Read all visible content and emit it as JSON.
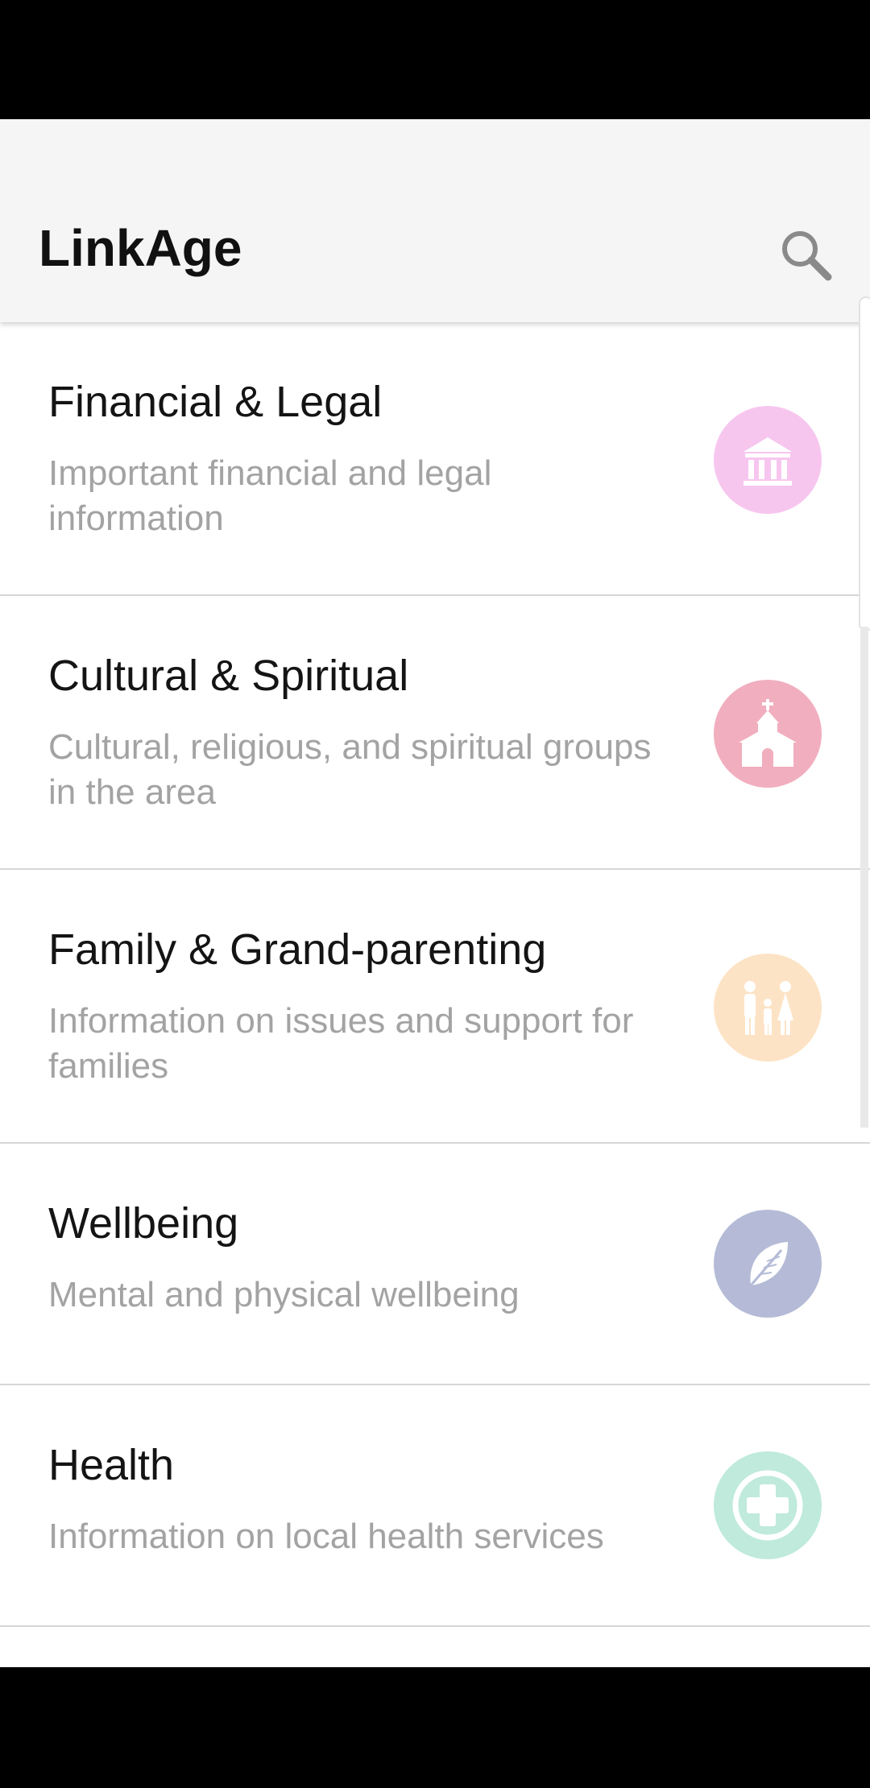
{
  "app_bar": {
    "title": "LinkAge",
    "search_icon": "search-icon"
  },
  "categories": [
    {
      "title": "Financial & Legal",
      "description": "Important financial and legal information",
      "icon": "bank-icon",
      "color": "#f7c6ef"
    },
    {
      "title": "Cultural & Spiritual",
      "description": "Cultural, religious, and spiritual groups in the area",
      "icon": "church-icon",
      "color": "#f1aebe"
    },
    {
      "title": "Family & Grand-parenting",
      "description": "Information on issues and support for families",
      "icon": "family-icon",
      "color": "#fde3c5"
    },
    {
      "title": "Wellbeing",
      "description": "Mental and physical wellbeing",
      "icon": "leaf-icon",
      "color": "#b5bbd6"
    },
    {
      "title": "Health",
      "description": "Information on local health services",
      "icon": "health-cross-icon",
      "color": "#bfeadc"
    }
  ]
}
